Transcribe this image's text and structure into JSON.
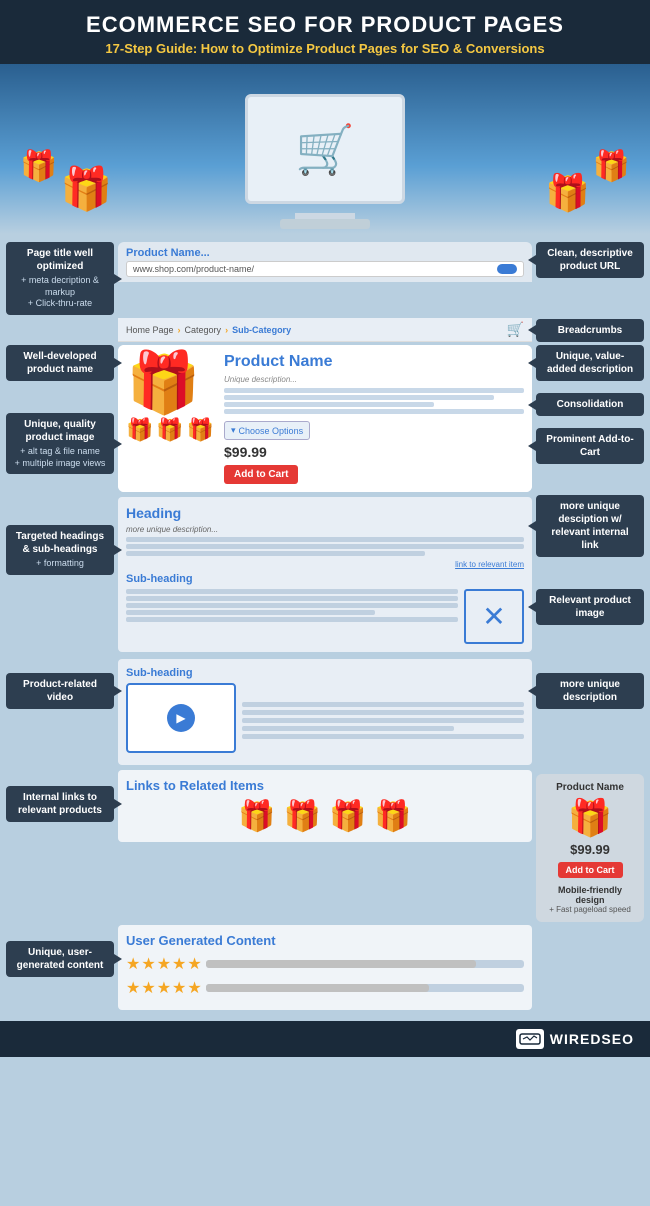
{
  "header": {
    "title": "ECOMMERCE SEO FOR PRODUCT PAGES",
    "subtitle": "17-Step Guide: How to Optimize Product Pages for SEO & Conversions"
  },
  "left_annotations": [
    {
      "id": "page-title-annot",
      "label": "Page title well optimized",
      "sub": "+ meta decription & markup\n+ Click-thru-rate"
    },
    {
      "id": "product-name-annot",
      "label": "Well-developed product name",
      "sub": ""
    },
    {
      "id": "product-image-annot",
      "label": "Unique, quality product image",
      "sub": "+ alt tag & file name\n+ multiple image views"
    },
    {
      "id": "headings-annot",
      "label": "Targeted headings & sub-headings",
      "sub": "+ formatting"
    },
    {
      "id": "video-annot",
      "label": "Product-related video",
      "sub": ""
    },
    {
      "id": "internal-links-annot",
      "label": "Internal links to relevant products",
      "sub": ""
    },
    {
      "id": "ugc-annot",
      "label": "Unique, user-generated content",
      "sub": ""
    }
  ],
  "right_annotations": [
    {
      "id": "url-annot",
      "label": "Clean, descriptive product URL",
      "sub": ""
    },
    {
      "id": "breadcrumb-annot",
      "label": "Breadcrumbs",
      "sub": ""
    },
    {
      "id": "desc-annot",
      "label": "Unique, value-added description",
      "sub": ""
    },
    {
      "id": "consolidation-annot",
      "label": "Consolidation",
      "sub": ""
    },
    {
      "id": "add-to-cart-annot",
      "label": "Prominent Add-to-Cart",
      "sub": ""
    },
    {
      "id": "unique-desc-annot",
      "label": "more unique desciption w/ relevant internal link",
      "sub": ""
    },
    {
      "id": "product-image2-annot",
      "label": "Relevant product image",
      "sub": ""
    },
    {
      "id": "more-desc-annot",
      "label": "more unique description",
      "sub": ""
    }
  ],
  "product": {
    "name": "Product Name",
    "url": "www.shop.com/product-name/",
    "title_bar": "Product Name...",
    "breadcrumbs": [
      "Home Page",
      "Category",
      "Sub-Category"
    ],
    "price": "$99.99",
    "add_to_cart": "Add to Cart",
    "choose_options": "Choose Options",
    "description_hint": "Unique description..."
  },
  "sections": {
    "heading": "Heading",
    "more_unique_desc": "more unique description...",
    "internal_link": "link to relevant item",
    "subheading1": "Sub-heading",
    "subheading2": "Sub-heading",
    "links_heading": "Links to Related Items",
    "ugc_heading": "User Generated Content"
  },
  "mobile_card": {
    "title": "Product Name",
    "price": "$99.99",
    "add_to_cart": "Add to Cart",
    "label": "Mobile-friendly design",
    "sub": "+ Fast pageload speed"
  },
  "footer": {
    "brand": "WIREDSEO"
  }
}
